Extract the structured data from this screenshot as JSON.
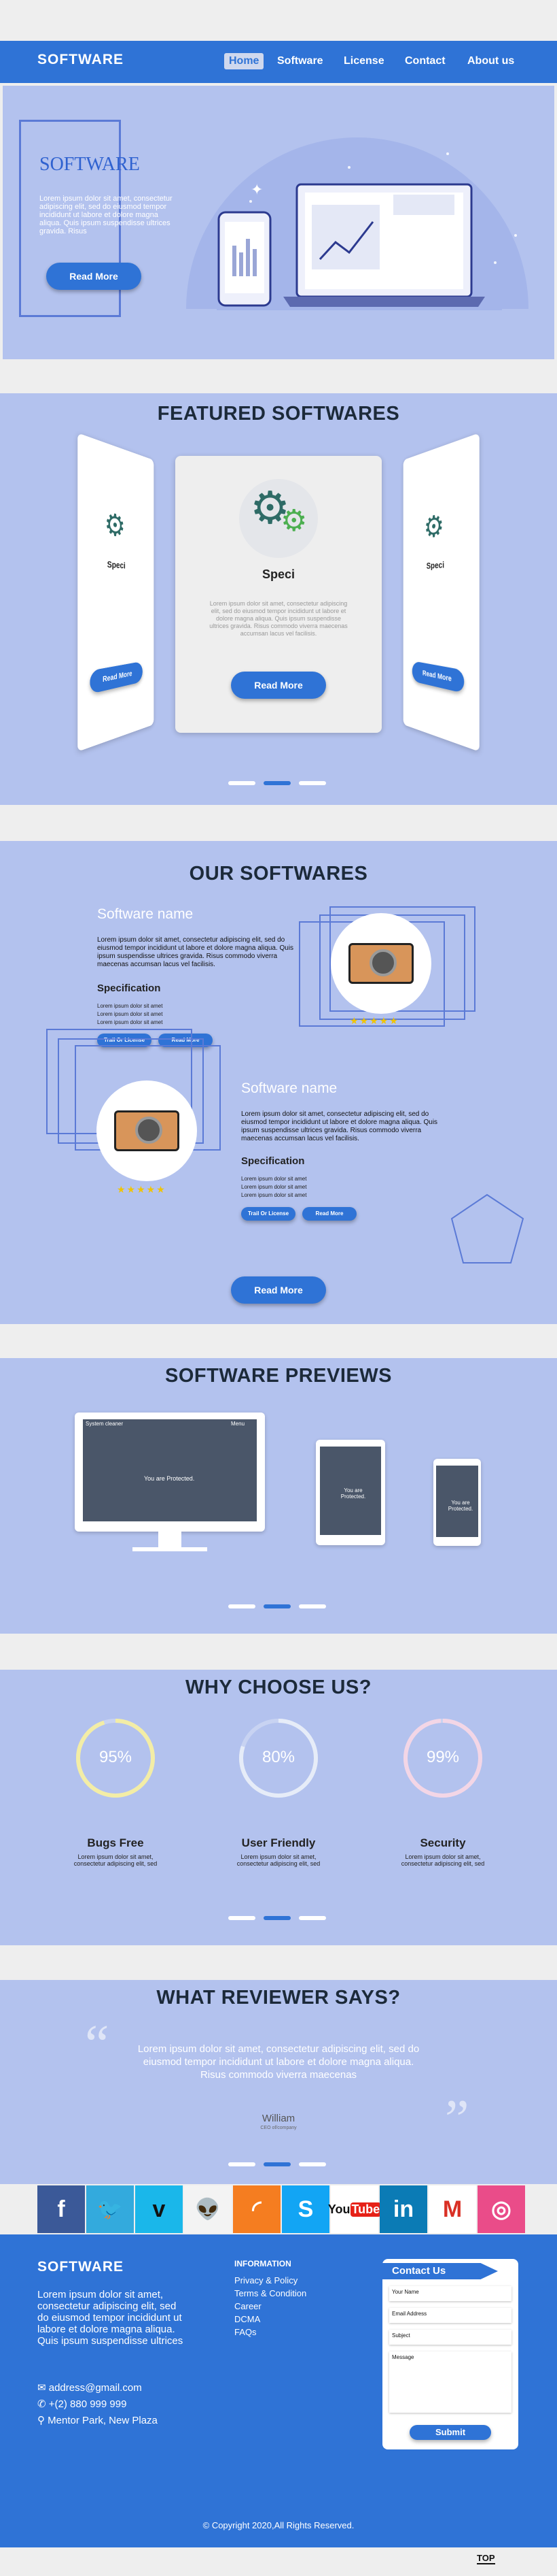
{
  "nav": {
    "brand": "SOFTWARE",
    "links": [
      "Home",
      "Software",
      "License",
      "Contact",
      "About us"
    ]
  },
  "hero": {
    "title": "SOFTWARE",
    "text": "Lorem ipsum dolor sit amet, consectetur adipiscing elit, sed do eiusmod tempor incididunt ut labore et dolore magna aliqua. Quis ipsum suspendisse ultrices gravida. Risus",
    "button": "Read More"
  },
  "featured": {
    "title": "FEATURED SOFTWARES",
    "center_name": "Speci",
    "left_name": "Speci",
    "right_name": "Speci",
    "center_text": "Lorem ipsum dolor sit amet, consectetur adipiscing elit, sed do eiusmod tempor incididunt ut labore et dolore magna aliqua. Quis ipsum suspendisse ultrices gravida. Risus commodo viverra maecenas accumsan lacus vel facilisis.",
    "button": "Read More",
    "side_button": "Read More"
  },
  "ours": {
    "title": "OUR SOFTWARES",
    "items": [
      {
        "name": "Software name",
        "text": "Lorem ipsum dolor sit amet, consectetur adipiscing elit, sed do eiusmod tempor incididunt ut labore et dolore magna aliqua. Quis ipsum suspendisse ultrices gravida. Risus commodo viverra maecenas accumsan lacus vel facilisis.",
        "spec": "Specification",
        "lines": [
          "Lorem ipsum dolor sit amet",
          "Lorem ipsum dolor sit amet",
          "Lorem ipsum dolor sit amet"
        ],
        "b1": "Trail Or License",
        "b2": "Read More"
      },
      {
        "name": "Software name",
        "text": "Lorem ipsum dolor sit amet, consectetur adipiscing elit, sed do eiusmod tempor incididunt ut labore et dolore magna aliqua. Quis ipsum suspendisse ultrices gravida. Risus commodo viverra maecenas accumsan lacus vel facilisis.",
        "spec": "Specification",
        "lines": [
          "Lorem ipsum dolor sit amet",
          "Lorem ipsum dolor sit amet",
          "Lorem ipsum dolor sit amet"
        ],
        "b1": "Trail Or License",
        "b2": "Read More"
      }
    ],
    "button": "Read More",
    "stars": "★★★★★"
  },
  "previews": {
    "title": "SOFTWARE PREVIEWS",
    "monitor_title": "System cleaner",
    "monitor_menu": "Menu",
    "protected": "You are Protected."
  },
  "why": {
    "title": "WHY CHOOSE US?",
    "items": [
      {
        "pct": "95%",
        "value": 0.95,
        "color": "#f3eda6",
        "label": "Bugs Free",
        "text": "Lorem ipsum dolor sit amet, consectetur adipiscing elit, sed"
      },
      {
        "pct": "80%",
        "value": 0.8,
        "color": "#e6ecf8",
        "label": "User Friendly",
        "text": "Lorem ipsum dolor sit amet, consectetur adipiscing elit, sed"
      },
      {
        "pct": "99%",
        "value": 0.99,
        "color": "#f3d6e6",
        "label": "Security",
        "text": "Lorem ipsum dolor sit amet, consectetur adipiscing elit, sed"
      }
    ]
  },
  "reviews": {
    "title": "WHAT REVIEWER SAYS?",
    "quote": "Lorem ipsum dolor sit amet, consectetur adipiscing elit, sed do eiusmod tempor incididunt ut labore et dolore magna aliqua. Risus commodo viverra maecenas",
    "name": "William",
    "role": "CEO of/company"
  },
  "social": [
    {
      "name": "facebook",
      "color": "#3b5998",
      "glyph": "f"
    },
    {
      "name": "twitter",
      "color": "#33aadd",
      "glyph": "🐦"
    },
    {
      "name": "vimeo",
      "color": "#1ab7ea",
      "glyph": "v"
    },
    {
      "name": "reddit",
      "color": "#f3f3f3",
      "glyph": "👽"
    },
    {
      "name": "rss",
      "color": "#f57d20",
      "glyph": "◜"
    },
    {
      "name": "skype",
      "color": "#12a5f4",
      "glyph": "S"
    },
    {
      "name": "youtube",
      "color": "#ffffff",
      "glyph": "You"
    },
    {
      "name": "linkedin",
      "color": "#0b7bb5",
      "glyph": "in"
    },
    {
      "name": "gmail",
      "color": "#ffffff",
      "glyph": "M"
    },
    {
      "name": "dribbble",
      "color": "#ea4c89",
      "glyph": "◎"
    }
  ],
  "footer": {
    "brand": "SOFTWARE",
    "about": "Lorem ipsum dolor sit amet, consectetur adipiscing elit, sed do eiusmod tempor incididunt ut labore et dolore magna aliqua. Quis ipsum suspendisse ultrices",
    "email": "address@gmail.com",
    "phone": "+(2) 880 999 999",
    "address": "Mentor Park, New Plaza",
    "info_title": "INFORMATION",
    "info_links": [
      "Privacy & Policy",
      "Terms & Condition",
      "Career",
      "DCMA",
      "FAQs"
    ],
    "contact_title": "Contact Us",
    "fields": [
      "Your Name",
      "Email Address",
      "Subject",
      "Message"
    ],
    "submit": "Submit",
    "copyright": "Copyright 2020,All Rights Reserved.",
    "top": "TOP"
  }
}
